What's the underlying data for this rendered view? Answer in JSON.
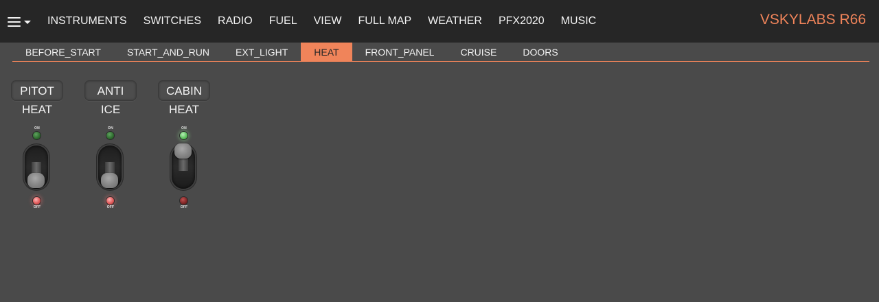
{
  "app": {
    "brand": "VSKYLABS R66",
    "accent_color": "#f0845a"
  },
  "menu_toggle": {
    "icon": "hamburger-menu-icon"
  },
  "nav": {
    "items": [
      "INSTRUMENTS",
      "SWITCHES",
      "RADIO",
      "FUEL",
      "VIEW",
      "FULL MAP",
      "WEATHER",
      "PFX2020",
      "MUSIC"
    ]
  },
  "subtabs": {
    "items": [
      "BEFORE_START",
      "START_AND_RUN",
      "EXT_LIGHT",
      "HEAT",
      "FRONT_PANEL",
      "CRUISE",
      "DOORS"
    ],
    "active": "HEAT"
  },
  "switches": [
    {
      "label_top": "PITOT",
      "label_bottom": "HEAT",
      "on_label": "ON",
      "off_label": "OFF",
      "state": "off"
    },
    {
      "label_top": "ANTI",
      "label_bottom": "ICE",
      "on_label": "ON",
      "off_label": "OFF",
      "state": "off"
    },
    {
      "label_top": "CABIN",
      "label_bottom": "HEAT",
      "on_label": "ON",
      "off_label": "OFF",
      "state": "on"
    }
  ]
}
